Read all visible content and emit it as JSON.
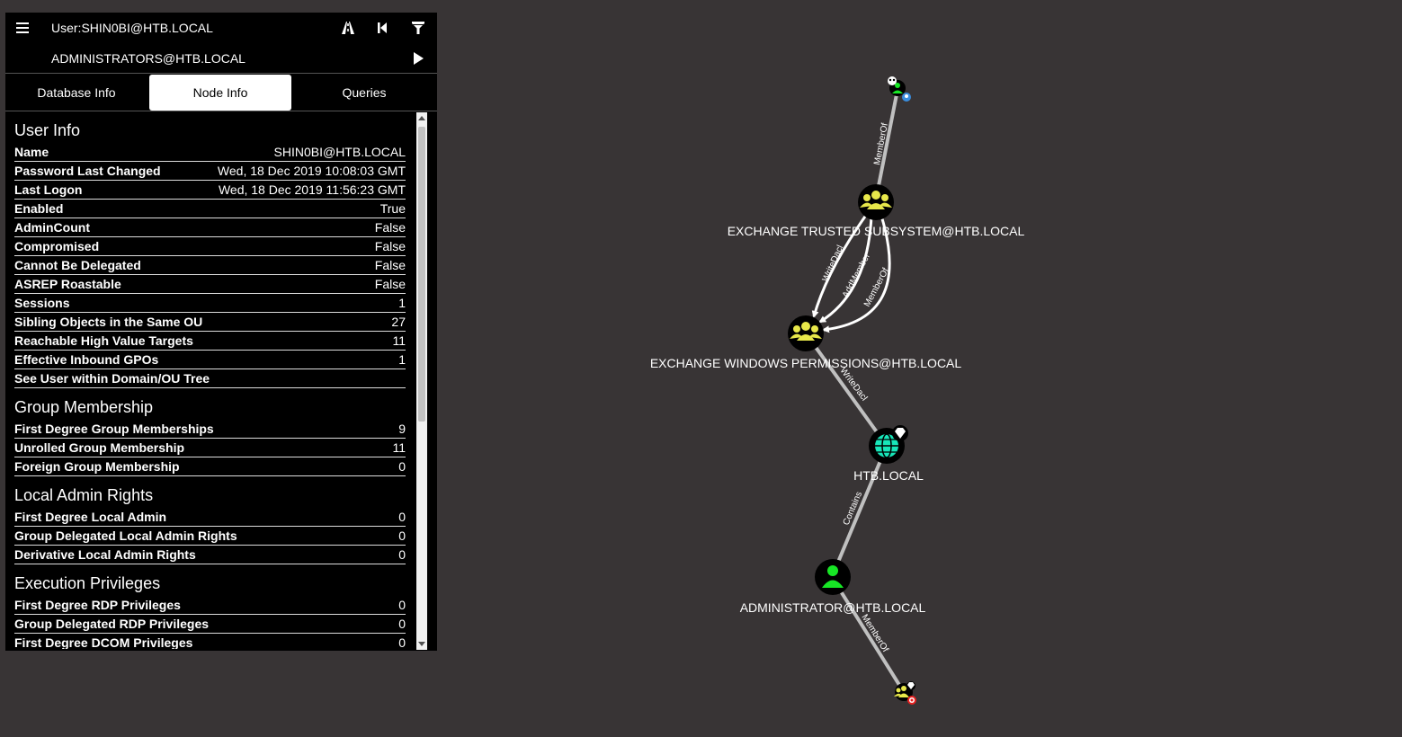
{
  "search": {
    "start_node": "User:SHIN0BI@HTB.LOCAL",
    "target_node": "ADMINISTRATORS@HTB.LOCAL"
  },
  "tabs": [
    "Database Info",
    "Node Info",
    "Queries"
  ],
  "active_tab": "Node Info",
  "user_info": {
    "title": "User Info",
    "rows": [
      {
        "label": "Name",
        "value": "SHIN0BI@HTB.LOCAL"
      },
      {
        "label": "Password Last Changed",
        "value": "Wed, 18 Dec 2019 10:08:03 GMT"
      },
      {
        "label": "Last Logon",
        "value": "Wed, 18 Dec 2019 11:56:23 GMT"
      },
      {
        "label": "Enabled",
        "value": "True"
      },
      {
        "label": "AdminCount",
        "value": "False"
      },
      {
        "label": "Compromised",
        "value": "False"
      },
      {
        "label": "Cannot Be Delegated",
        "value": "False"
      },
      {
        "label": "ASREP Roastable",
        "value": "False"
      },
      {
        "label": "Sessions",
        "value": "1"
      },
      {
        "label": "Sibling Objects in the Same OU",
        "value": "27"
      },
      {
        "label": "Reachable High Value Targets",
        "value": "11"
      },
      {
        "label": "Effective Inbound GPOs",
        "value": "1"
      },
      {
        "label": "See User within Domain/OU Tree",
        "value": ""
      }
    ]
  },
  "group_membership": {
    "title": "Group Membership",
    "rows": [
      {
        "label": "First Degree Group Memberships",
        "value": "9"
      },
      {
        "label": "Unrolled Group Membership",
        "value": "11"
      },
      {
        "label": "Foreign Group Membership",
        "value": "0"
      }
    ]
  },
  "local_admin": {
    "title": "Local Admin Rights",
    "rows": [
      {
        "label": "First Degree Local Admin",
        "value": "0"
      },
      {
        "label": "Group Delegated Local Admin Rights",
        "value": "0"
      },
      {
        "label": "Derivative Local Admin Rights",
        "value": "0"
      }
    ]
  },
  "execution": {
    "title": "Execution Privileges",
    "rows": [
      {
        "label": "First Degree RDP Privileges",
        "value": "0"
      },
      {
        "label": "Group Delegated RDP Privileges",
        "value": "0"
      },
      {
        "label": "First Degree DCOM Privileges",
        "value": "0"
      }
    ]
  },
  "graph": {
    "nodes": {
      "n1": "EXCHANGE TRUSTED SUBSYSTEM@HTB.LOCAL",
      "n2": "EXCHANGE WINDOWS PERMISSIONS@HTB.LOCAL",
      "n3": "HTB.LOCAL",
      "n4": "ADMINISTRATOR@HTB.LOCAL"
    },
    "edges": {
      "e0": "MemberOf",
      "e1": "WriteDacl",
      "e2": "AddMember",
      "e3": "MemberOf",
      "e4": "WriteDacl",
      "e5": "Contains",
      "e6": "MemberOf"
    }
  },
  "colors": {
    "background": "#383435",
    "panel": "#000000",
    "group_node": "#e8e84a",
    "user_node": "#17e625",
    "domain_node": "#17e6b9",
    "edge": "#c0c0c0"
  }
}
